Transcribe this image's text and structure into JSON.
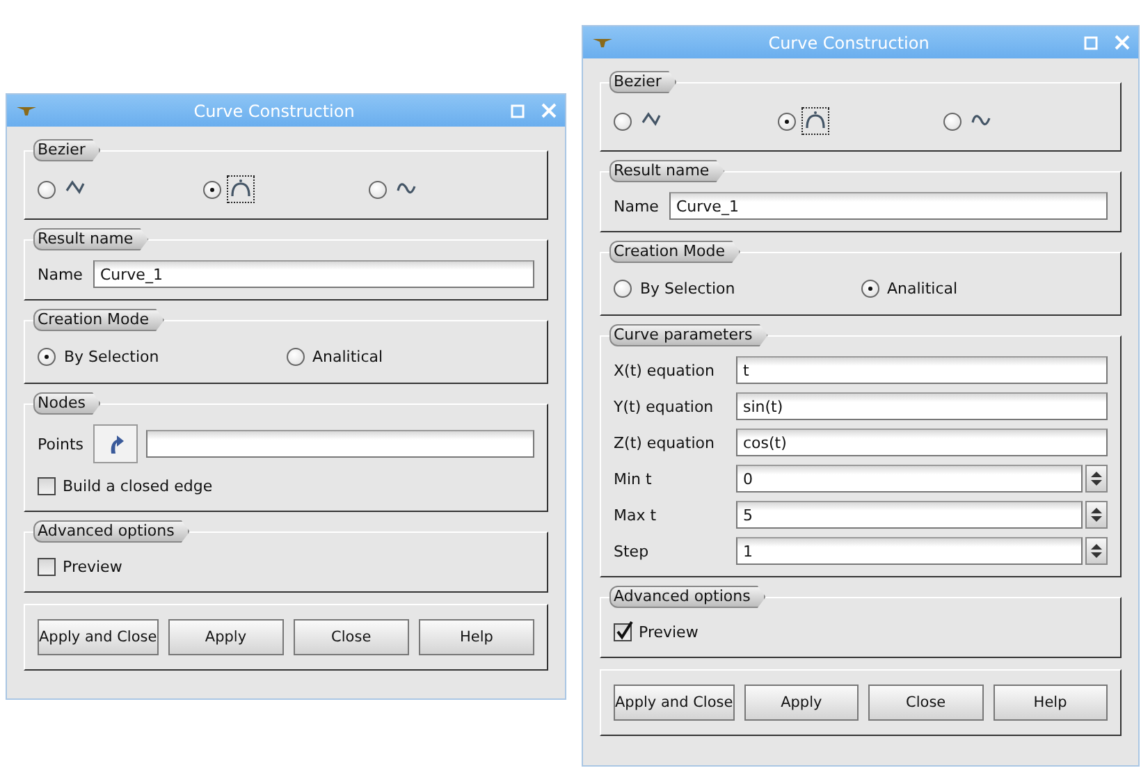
{
  "windows": [
    {
      "title": "Curve Construction",
      "groups": [
        {
          "kind": "bezier",
          "legend": "Bezier",
          "options": [
            {
              "kind": "polyline",
              "selected": false
            },
            {
              "kind": "arc",
              "selected": true
            },
            {
              "kind": "wave",
              "selected": false
            }
          ]
        },
        {
          "kind": "fields",
          "legend": "Result name",
          "rows": [
            {
              "kind": "text",
              "label": "Name",
              "value": "Curve_1"
            }
          ]
        },
        {
          "kind": "radios",
          "legend": "Creation Mode",
          "options": [
            {
              "label": "By Selection",
              "selected": true
            },
            {
              "label": "Analitical",
              "selected": false
            }
          ]
        },
        {
          "kind": "fields",
          "legend": "Nodes",
          "rows": [
            {
              "kind": "selector",
              "label": "Points"
            }
          ],
          "checks": [
            {
              "label": "Build a closed edge",
              "checked": false
            }
          ]
        },
        {
          "kind": "fields",
          "legend": "Advanced options",
          "checks": [
            {
              "label": "Preview",
              "checked": false
            }
          ]
        }
      ],
      "buttons": [
        "Apply and Close",
        "Apply",
        "Close",
        "Help"
      ]
    },
    {
      "title": "Curve Construction",
      "groups": [
        {
          "kind": "bezier",
          "legend": "Bezier",
          "options": [
            {
              "kind": "polyline",
              "selected": false
            },
            {
              "kind": "arc",
              "selected": true
            },
            {
              "kind": "wave",
              "selected": false
            }
          ]
        },
        {
          "kind": "fields",
          "legend": "Result name",
          "rows": [
            {
              "kind": "text",
              "label": "Name",
              "value": "Curve_1"
            }
          ]
        },
        {
          "kind": "radios",
          "legend": "Creation Mode",
          "options": [
            {
              "label": "By Selection",
              "selected": false
            },
            {
              "label": "Analitical",
              "selected": true
            }
          ]
        },
        {
          "kind": "fields",
          "legend": "Curve parameters",
          "rows": [
            {
              "kind": "text",
              "label": "X(t) equation",
              "value": "t"
            },
            {
              "kind": "text",
              "label": "Y(t) equation",
              "value": "sin(t)"
            },
            {
              "kind": "text",
              "label": "Z(t) equation",
              "value": "cos(t)"
            },
            {
              "kind": "spin",
              "label": "Min t",
              "value": "0"
            },
            {
              "kind": "spin",
              "label": "Max t",
              "value": "5"
            },
            {
              "kind": "spin",
              "label": "Step",
              "value": "1"
            }
          ]
        },
        {
          "kind": "fields",
          "legend": "Advanced options",
          "checks": [
            {
              "label": "Preview",
              "checked": true
            }
          ]
        }
      ],
      "buttons": [
        "Apply and Close",
        "Apply",
        "Close",
        "Help"
      ]
    }
  ]
}
